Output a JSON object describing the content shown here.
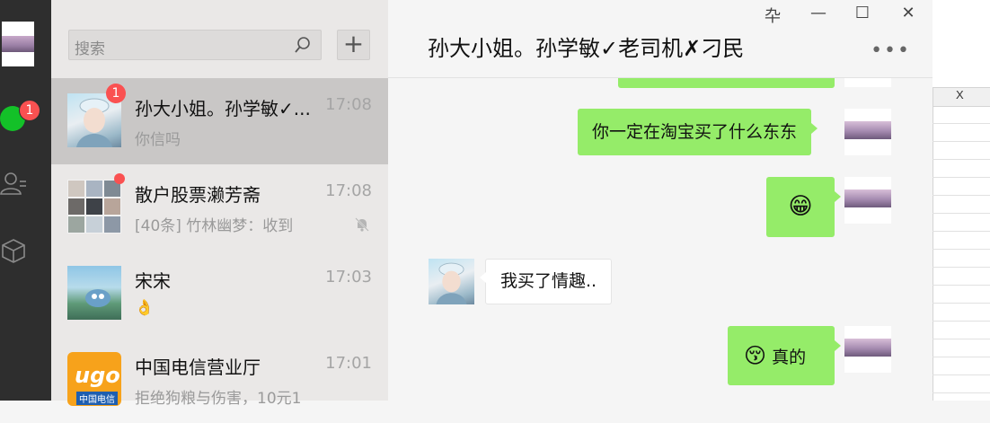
{
  "window": {
    "pin_glyph": "卆",
    "minimize_glyph": "—",
    "maximize_glyph": "☐",
    "close_glyph": "✕"
  },
  "rail": {
    "chat_badge": "1"
  },
  "search": {
    "placeholder": "搜索",
    "add_glyph": "+"
  },
  "conversations": [
    {
      "name": "孙大小姐。孙学敏✓...",
      "time": "17:08",
      "preview": "你信吗",
      "badge": "1"
    },
    {
      "name": "散户股票濑芳斋",
      "time": "17:08",
      "preview": "[40条] 竹林幽梦：收到"
    },
    {
      "name": "宋宋",
      "time": "17:03",
      "preview": "👌"
    },
    {
      "name": "中国电信营业厅",
      "time": "17:01",
      "preview": "拒绝狗粮与伤害，10元1",
      "logo_text": "ugo",
      "logo_sub": "中国电信"
    }
  ],
  "chat": {
    "title": "孙大小姐。孙学敏✓老司机✗刁民",
    "more": "•••",
    "messages": [
      {
        "direction": "out",
        "text": "你一定在淘宝买了什么东东"
      },
      {
        "direction": "out",
        "text": "😁"
      },
      {
        "direction": "in",
        "text": "我买了情趣.."
      },
      {
        "direction": "out",
        "emoji": "😚",
        "text": "真的"
      }
    ]
  },
  "sheet": {
    "column_label": "X"
  },
  "colors": {
    "accent_green": "#95ec69",
    "badge_red": "#fa5151",
    "rail_bg": "#2e2e2e"
  }
}
